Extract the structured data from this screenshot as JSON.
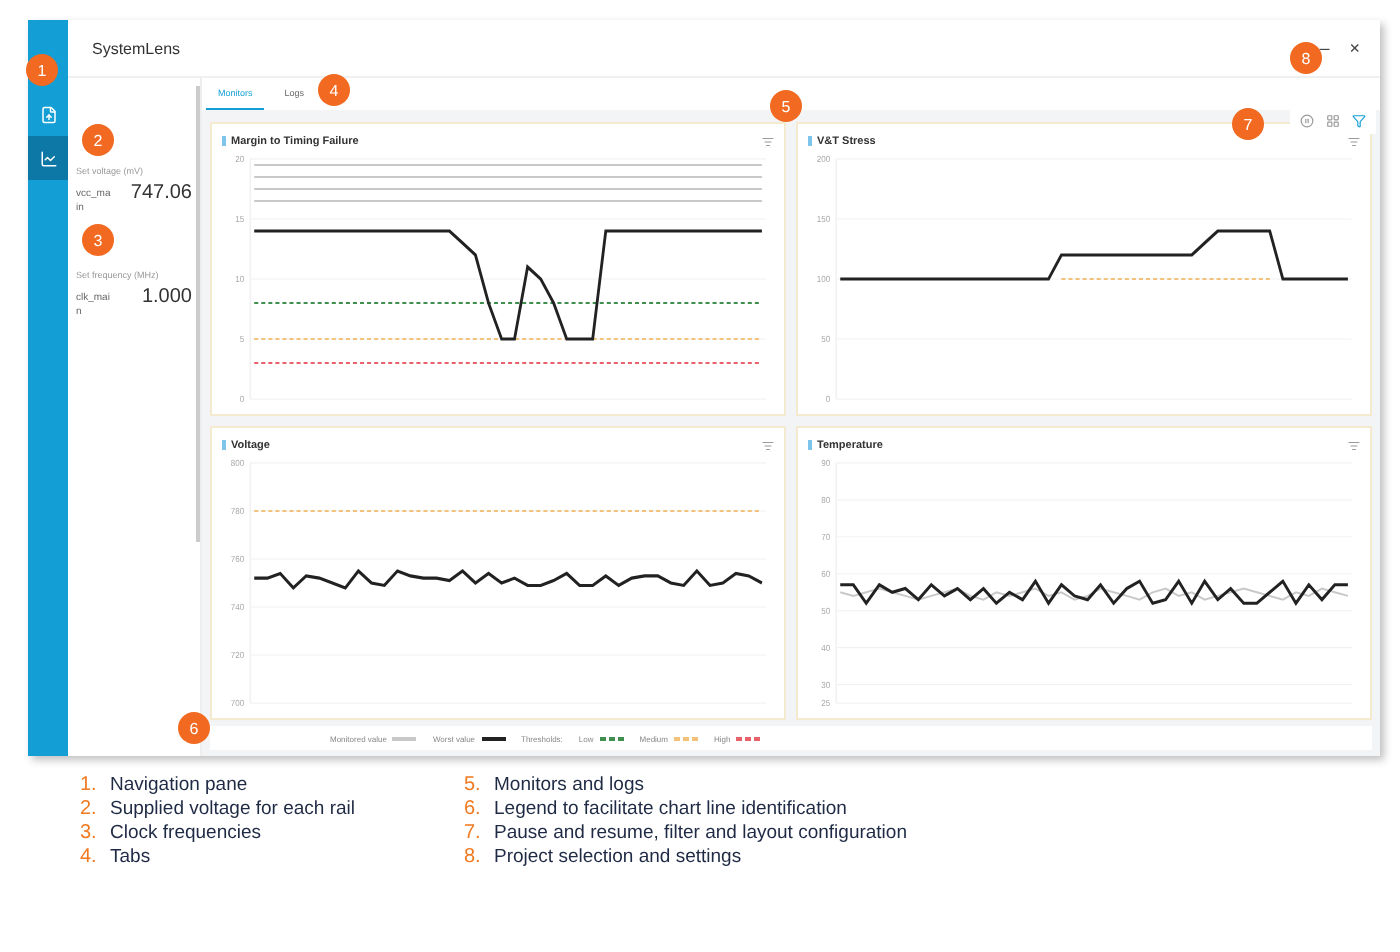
{
  "window": {
    "title": "SystemLens",
    "controls": [
      "–",
      "×"
    ]
  },
  "navigation": {
    "items": [
      {
        "kind": "file",
        "selected": false
      },
      {
        "kind": "chart",
        "selected": true
      }
    ]
  },
  "rails": [
    {
      "label": "Set voltage (mV)",
      "name": "vcc_main",
      "value": "747.06"
    },
    {
      "label": "Set frequency (MHz)",
      "name": "clk_main",
      "value": "1.000"
    }
  ],
  "tabs": [
    {
      "label": "Monitors",
      "selected": true
    },
    {
      "label": "Logs",
      "selected": false
    }
  ],
  "toolbar": [
    {
      "kind": "pause"
    },
    {
      "kind": "layout"
    },
    {
      "kind": "filter"
    }
  ],
  "charts": [
    {
      "title": "Margin to Timing Failure",
      "chart_data": {
        "type": "line",
        "grid": true,
        "ylim": [
          0,
          20
        ],
        "yticks": [
          0,
          5,
          10,
          15,
          20
        ],
        "series": [
          {
            "color": "#c8c8c8",
            "values": [
              19.5,
              19.5,
              19.5,
              19.5,
              19.5,
              19.5,
              19.5,
              19.5,
              19.5,
              19.5,
              19.5,
              19.5,
              19.5,
              19.5,
              19.5,
              19.5,
              19.5,
              19.5,
              19.5,
              19.5,
              19.5,
              19.5,
              19.5,
              19.5,
              19.5,
              19.5,
              19.5,
              19.5,
              19.5,
              19.5,
              19.5,
              19.5,
              19.5,
              19.5,
              19.5,
              19.5,
              19.5,
              19.5,
              19.5,
              19.5
            ]
          },
          {
            "color": "#c8c8c8",
            "values": [
              18.5,
              18.5,
              18.5,
              18.5,
              18.5,
              18.5,
              18.5,
              18.5,
              18.5,
              18.5,
              18.5,
              18.5,
              18.5,
              18.5,
              18.5,
              18.5,
              18.5,
              18.5,
              18.5,
              18.5,
              18.5,
              18.5,
              18.5,
              18.5,
              18.5,
              18.5,
              18.5,
              18.5,
              18.5,
              18.5,
              18.5,
              18.5,
              18.5,
              18.5,
              18.5,
              18.5,
              18.5,
              18.5,
              18.5,
              18.5
            ]
          },
          {
            "color": "#c8c8c8",
            "values": [
              17.5,
              17.5,
              17.5,
              17.5,
              17.5,
              17.5,
              17.5,
              17.5,
              17.5,
              17.5,
              17.5,
              17.5,
              17.5,
              17.5,
              17.5,
              17.5,
              17.5,
              17.5,
              17.5,
              17.5,
              17.5,
              17.5,
              17.5,
              17.5,
              17.5,
              17.5,
              17.5,
              17.5,
              17.5,
              17.5,
              17.5,
              17.5,
              17.5,
              17.5,
              17.5,
              17.5,
              17.5,
              17.5,
              17.5,
              17.5
            ]
          },
          {
            "color": "#c8c8c8",
            "values": [
              16.5,
              16.5,
              16.5,
              16.5,
              16.5,
              16.5,
              16.5,
              16.5,
              16.5,
              16.5,
              16.5,
              16.5,
              16.5,
              16.5,
              16.5,
              16.5,
              16.5,
              16.5,
              16.5,
              16.5,
              16.5,
              16.5,
              16.5,
              16.5,
              16.5,
              16.5,
              16.5,
              16.5,
              16.5,
              16.5,
              16.5,
              16.5,
              16.5,
              16.5,
              16.5,
              16.5,
              16.5,
              16.5,
              16.5,
              16.5
            ]
          },
          {
            "color": "#3f8f4f",
            "line_style": "dashed",
            "values": [
              8,
              8,
              8,
              8,
              8,
              8,
              8,
              8,
              8,
              8,
              8,
              8,
              8,
              8,
              8,
              8,
              8,
              8,
              8,
              8,
              8,
              8,
              8,
              8,
              8,
              8,
              8,
              8,
              8,
              8,
              8,
              8,
              8,
              8,
              8,
              8,
              8,
              8,
              8,
              8
            ]
          },
          {
            "color": "#f2c27a",
            "line_style": "dashed",
            "values": [
              5,
              5,
              5,
              5,
              5,
              5,
              5,
              5,
              5,
              5,
              5,
              5,
              5,
              5,
              5,
              5,
              5,
              5,
              5,
              5,
              5,
              5,
              5,
              5,
              5,
              5,
              5,
              5,
              5,
              5,
              5,
              5,
              5,
              5,
              5,
              5,
              5,
              5,
              5,
              5
            ]
          },
          {
            "color": "#e8616b",
            "line_style": "dashed",
            "values": [
              3,
              3,
              3,
              3,
              3,
              3,
              3,
              3,
              3,
              3,
              3,
              3,
              3,
              3,
              3,
              3,
              3,
              3,
              3,
              3,
              3,
              3,
              3,
              3,
              3,
              3,
              3,
              3,
              3,
              3,
              3,
              3,
              3,
              3,
              3,
              3,
              3,
              3,
              3,
              3
            ]
          },
          {
            "color": "#222222",
            "values": [
              14,
              14,
              14,
              14,
              14,
              14,
              14,
              14,
              14,
              14,
              14,
              14,
              14,
              14,
              14,
              14,
              13,
              12,
              8,
              5,
              5,
              11,
              10,
              8,
              5,
              5,
              5,
              14,
              14,
              14,
              14,
              14,
              14,
              14,
              14,
              14,
              14,
              14,
              14,
              14
            ]
          }
        ]
      }
    },
    {
      "title": "V&T Stress",
      "chart_data": {
        "type": "line",
        "grid": true,
        "ylim": [
          0,
          200
        ],
        "yticks": [
          0,
          50,
          100,
          150,
          200
        ],
        "series": [
          {
            "color": "#f2c27a",
            "line_style": "dashed",
            "values": [
              null,
              null,
              null,
              null,
              null,
              null,
              null,
              null,
              null,
              null,
              null,
              null,
              null,
              null,
              null,
              null,
              null,
              100,
              100,
              100,
              100,
              100,
              100,
              100,
              100,
              100,
              100,
              100,
              100,
              100,
              100,
              100,
              100,
              100,
              null,
              null,
              null,
              null,
              null,
              null
            ]
          },
          {
            "color": "#222222",
            "values": [
              100,
              100,
              100,
              100,
              100,
              100,
              100,
              100,
              100,
              100,
              100,
              100,
              100,
              100,
              100,
              100,
              100,
              120,
              120,
              120,
              120,
              120,
              120,
              120,
              120,
              120,
              120,
              120,
              130,
              140,
              140,
              140,
              140,
              140,
              100,
              100,
              100,
              100,
              100,
              100
            ]
          }
        ]
      }
    },
    {
      "title": "Voltage",
      "chart_data": {
        "type": "line",
        "grid": true,
        "ylim": [
          700,
          800
        ],
        "yticks": [
          700,
          720,
          740,
          760,
          780,
          800
        ],
        "series": [
          {
            "color": "#f2c27a",
            "line_style": "dashed",
            "values": [
              780,
              780,
              780,
              780,
              780,
              780,
              780,
              780,
              780,
              780,
              780,
              780,
              780,
              780,
              780,
              780,
              780,
              780,
              780,
              780,
              780,
              780,
              780,
              780,
              780,
              780,
              780,
              780,
              780,
              780,
              780,
              780,
              780,
              780,
              780,
              780,
              780,
              780,
              780,
              780
            ]
          },
          {
            "color": "#222222",
            "values": [
              752,
              752,
              754,
              748,
              753,
              752,
              750,
              748,
              755,
              750,
              749,
              755,
              753,
              752,
              752,
              751,
              755,
              750,
              754,
              750,
              752,
              749,
              749,
              751,
              754,
              749,
              749,
              753,
              749,
              752,
              753,
              753,
              750,
              749,
              755,
              749,
              750,
              754,
              753,
              750
            ]
          }
        ]
      }
    },
    {
      "title": "Temperature",
      "chart_data": {
        "type": "line",
        "grid": true,
        "ylim": [
          25,
          90
        ],
        "yticks": [
          25,
          30,
          40,
          50,
          60,
          70,
          80,
          90
        ],
        "series": [
          {
            "color": "#c8c8c8",
            "values": [
              55,
              54,
              55,
              56,
              55,
              54,
              53,
              54,
              55,
              56,
              54,
              53,
              55,
              54,
              55,
              56,
              54,
              55,
              53,
              54,
              56,
              55,
              54,
              53,
              55,
              56,
              54,
              55,
              53,
              54,
              55,
              56,
              55,
              54,
              53,
              55,
              54,
              56,
              55,
              54
            ]
          },
          {
            "color": "#222222",
            "values": [
              57,
              57,
              52,
              57,
              55,
              56,
              53,
              57,
              54,
              56,
              53,
              56,
              52,
              55,
              53,
              58,
              52,
              57,
              54,
              53,
              57,
              52,
              56,
              58,
              52,
              53,
              58,
              52,
              58,
              53,
              56,
              52,
              52,
              55,
              58,
              52,
              57,
              53,
              57,
              57
            ]
          }
        ]
      }
    }
  ],
  "legend": [
    {
      "kind": "line",
      "label": "Monitored value",
      "color": "#c8c8c8"
    },
    {
      "kind": "line",
      "label": "Worst value",
      "color": "#222222"
    },
    {
      "kind": "heading",
      "label": "Thresholds:"
    },
    {
      "kind": "dash",
      "label": "Low",
      "color": "#3f8f4f"
    },
    {
      "kind": "dash",
      "label": "Medium",
      "color": "#f2c27a"
    },
    {
      "kind": "dash",
      "label": "High",
      "color": "#e8616b"
    }
  ],
  "callouts": [
    "1",
    "2",
    "3",
    "4",
    "5",
    "6",
    "7",
    "8"
  ],
  "notes": [
    {
      "number": "1.",
      "text": "Navigation pane"
    },
    {
      "number": "2.",
      "text": "Supplied voltage for each rail"
    },
    {
      "number": "3.",
      "text": "Clock frequencies"
    },
    {
      "number": "4.",
      "text": "Tabs"
    },
    {
      "number": "5.",
      "text": "Monitors and logs"
    },
    {
      "number": "6.",
      "text": "Legend to facilitate chart line identification"
    },
    {
      "number": "7.",
      "text": "Pause and resume, filter and layout configuration"
    },
    {
      "number": "8.",
      "text": "Project selection and settings"
    }
  ]
}
